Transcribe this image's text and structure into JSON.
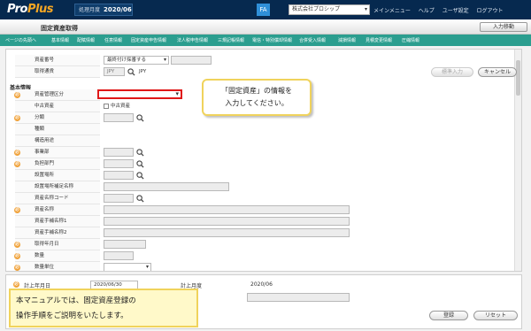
{
  "app": {
    "logo_main": "Pro",
    "logo_accent": "Plus"
  },
  "header": {
    "period_label": "処理月度",
    "period_value": "2020/06",
    "fa_badge": "FA",
    "company": "株式会社プロシップ",
    "links": [
      "メインメニュー",
      "ヘルプ",
      "ユーザ設定",
      "ログアウト"
    ]
  },
  "page": {
    "title": "固定資産取得",
    "entry_button": "入力移動"
  },
  "menu": [
    "ページの先頭へ",
    "基本情報",
    "配賦情報",
    "任意情報",
    "固定資産申告情報",
    "法人税申告情報",
    "三規記帳情報",
    "電信・特別償却情報",
    "合併受入情報",
    "減損情報",
    "見積変更情報",
    "圧縮情報"
  ],
  "form": {
    "asset_no_label": "資産番号",
    "asset_no_select": "最終付け採番する",
    "trade_currency_label": "取得通貨",
    "currency_code": "JPY",
    "currency_text": "JPY",
    "btn_template": "標準入力",
    "btn_cancel": "キャンセル",
    "section_basic": "基本情報",
    "fields": [
      {
        "label": "資産管理区分",
        "req": true
      },
      {
        "label": "中古資産",
        "req": false
      },
      {
        "label": "分類",
        "req": true
      },
      {
        "label": "種類",
        "req": false
      },
      {
        "label": "構造用途",
        "req": false
      },
      {
        "label": "事業部",
        "req": true
      },
      {
        "label": "負担部門",
        "req": true
      },
      {
        "label": "設置場所",
        "req": false
      },
      {
        "label": "設置場所補足名称",
        "req": false
      },
      {
        "label": "資産名称コード",
        "req": false
      },
      {
        "label": "資産名称",
        "req": true
      },
      {
        "label": "資産手補名称1",
        "req": false
      },
      {
        "label": "資産手補名称2",
        "req": false
      },
      {
        "label": "取得年月日",
        "req": true
      },
      {
        "label": "数量",
        "req": true
      },
      {
        "label": "数量単位",
        "req": true
      }
    ],
    "used_checkbox_label": "中古資産",
    "posting_month_label": "計上年月日",
    "posting_month_value": "2020/06/30",
    "posting_period_label": "計上月度",
    "posting_period_value": "2020/06"
  },
  "callout": {
    "line1": "「固定資産」の情報を",
    "line2": "入力してください。"
  },
  "note": {
    "line1": "本マニュアルでは、固定資産登録の",
    "line2": "操作手順をご説明をいたします。"
  },
  "buttons": {
    "register": "登録",
    "reset": "リセット"
  },
  "colors": {
    "header_bg": "#06294f",
    "menu_bg": "#2b9e8f",
    "required": "#f0a23a",
    "highlight": "#e01818",
    "callout_border": "#f0d35c"
  }
}
